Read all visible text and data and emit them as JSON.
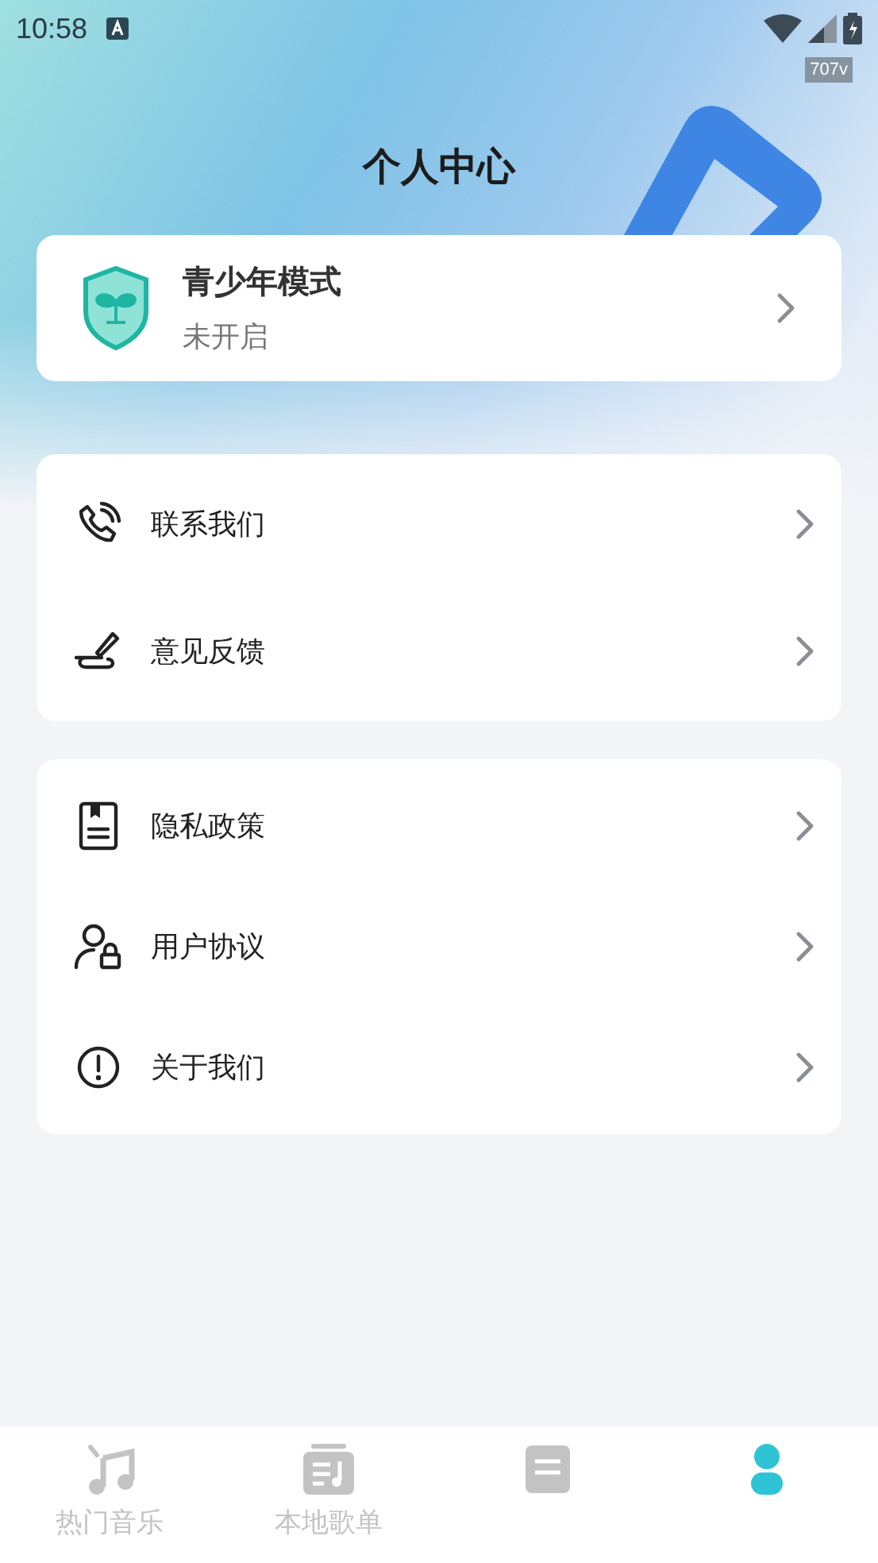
{
  "status_bar": {
    "time": "10:58",
    "badge": "707v"
  },
  "title": "个人中心",
  "youth_mode": {
    "title": "青少年模式",
    "status": "未开启"
  },
  "groups": [
    [
      {
        "label": "联系我们"
      },
      {
        "label": "意见反馈"
      }
    ],
    [
      {
        "label": "隐私政策"
      },
      {
        "label": "用户协议"
      },
      {
        "label": "关于我们"
      }
    ]
  ],
  "tab_bar": [
    {
      "label": "热门音乐",
      "selected": false
    },
    {
      "label": "本地歌单",
      "selected": false
    },
    {
      "selected": false
    },
    {
      "selected": true
    }
  ]
}
